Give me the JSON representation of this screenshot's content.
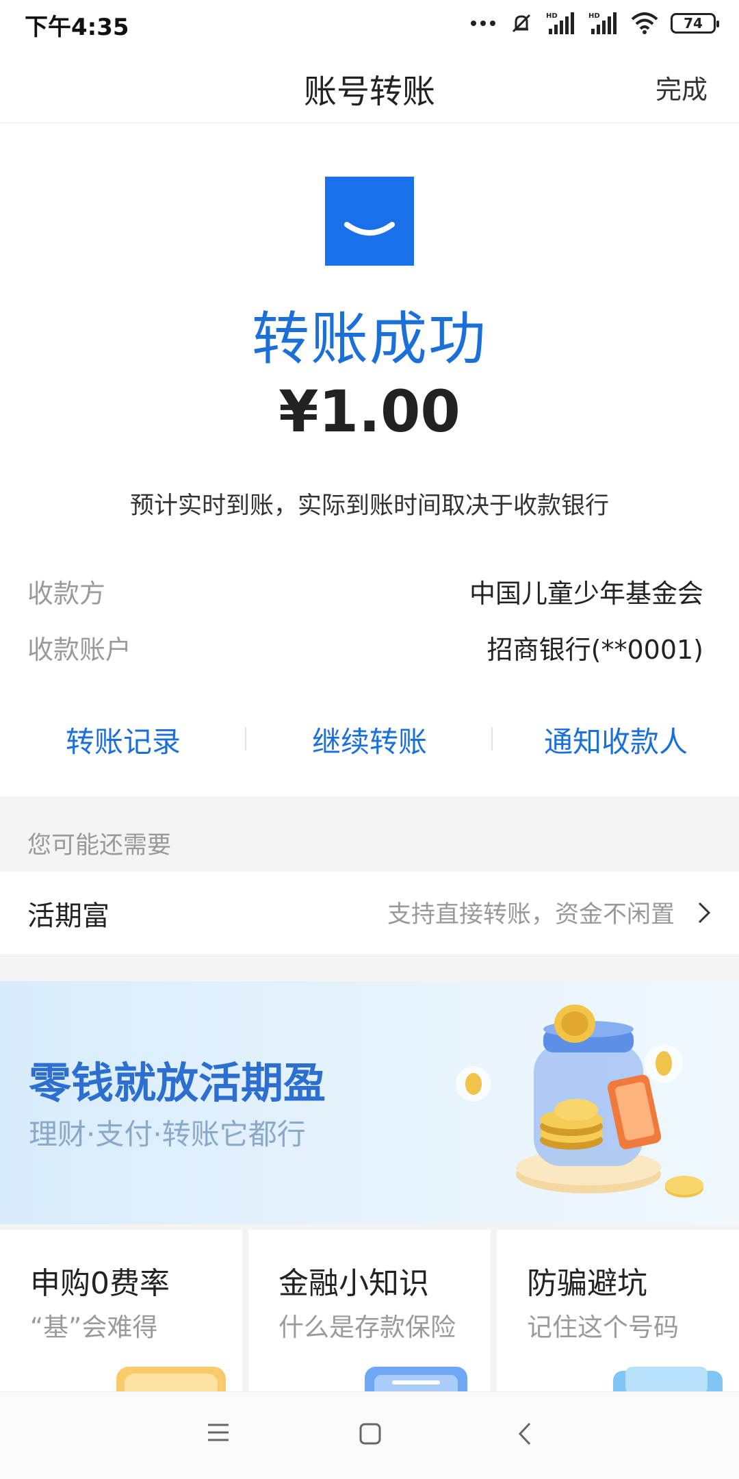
{
  "status_bar": {
    "time": "下午4:35",
    "battery": "74",
    "icons": [
      "more-dots-icon",
      "mute-icon",
      "signal-hd-icon",
      "signal-hd-icon",
      "wifi-icon",
      "battery-icon"
    ]
  },
  "header": {
    "title": "账号转账",
    "done_label": "完成"
  },
  "result": {
    "icon": "smile-icon",
    "icon_color": "#1a70e8",
    "title": "转账成功",
    "amount": "¥1.00",
    "note": "预计实时到账，实际到账时间取决于收款银行"
  },
  "details": {
    "payee_label": "收款方",
    "payee_value": "中国儿童少年基金会",
    "account_label": "收款账户",
    "account_value": "招商银行(**0001)"
  },
  "actions": [
    {
      "label": "转账记录"
    },
    {
      "label": "继续转账"
    },
    {
      "label": "通知收款人"
    }
  ],
  "suggest": {
    "heading": "您可能还需要",
    "product_name": "活期富",
    "product_desc": "支持直接转账，资金不闲置"
  },
  "banner": {
    "title": "零钱就放活期盈",
    "subtitle": "理财·支付·转账它都行"
  },
  "cards": [
    {
      "title": "申购0费率",
      "subtitle": "“基”会难得"
    },
    {
      "title": "金融小知识",
      "subtitle": "什么是存款保险"
    },
    {
      "title": "防骗避坑",
      "subtitle": "记住这个号码"
    }
  ],
  "colors": {
    "accent": "#1a6fd8",
    "muted": "#9a9a9a",
    "band": "#f4f4f5"
  }
}
